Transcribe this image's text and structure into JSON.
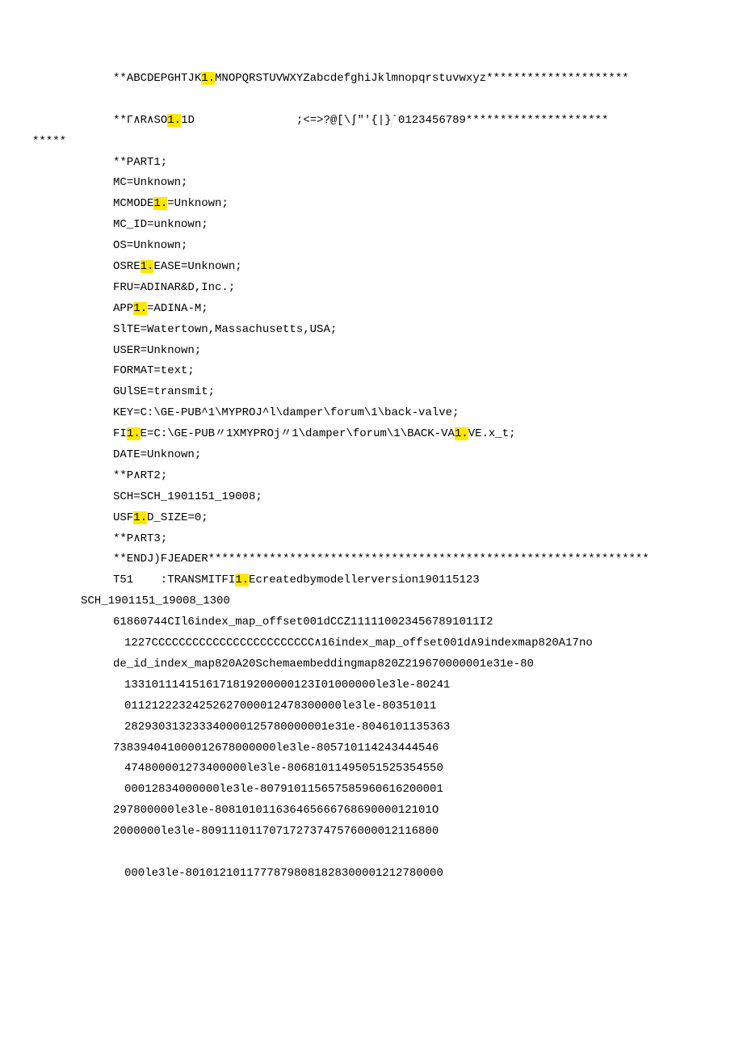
{
  "lines": [
    {
      "cls": "indent1",
      "segs": [
        {
          "t": "**ABCDEPGHTJK"
        },
        {
          "t": "1.",
          "hl": true
        },
        {
          "t": "MNOPQRSTUVWXYZabcdefghiJklmnopqrstuvwxyz*********************"
        }
      ]
    },
    {
      "cls": "blank"
    },
    {
      "cls": "indent1",
      "segs": [
        {
          "t": "**Γ∧R∧SO"
        },
        {
          "t": "1.",
          "hl": true
        },
        {
          "t": "1D               ;<=>?@[\\∫\"'{|}`0123456789*********************"
        }
      ]
    },
    {
      "cls": "noindent",
      "segs": [
        {
          "t": "*****"
        }
      ]
    },
    {
      "cls": "indent1",
      "segs": [
        {
          "t": "**PART1;"
        }
      ]
    },
    {
      "cls": "indent1",
      "segs": [
        {
          "t": "MC=Unknown;"
        }
      ]
    },
    {
      "cls": "indent1",
      "segs": [
        {
          "t": "MCMODE"
        },
        {
          "t": "1.",
          "hl": true
        },
        {
          "t": "=Unknown;"
        }
      ]
    },
    {
      "cls": "indent1",
      "segs": [
        {
          "t": "MC_ID=unknown;"
        }
      ]
    },
    {
      "cls": "indent1",
      "segs": [
        {
          "t": "OS=Unknown;"
        }
      ]
    },
    {
      "cls": "indent1",
      "segs": [
        {
          "t": "OSRE"
        },
        {
          "t": "1.",
          "hl": true
        },
        {
          "t": "EASE=Unknown;"
        }
      ]
    },
    {
      "cls": "indent1",
      "segs": [
        {
          "t": "FRU=ADINAR&D,Inc.;"
        }
      ]
    },
    {
      "cls": "indent1",
      "segs": [
        {
          "t": "APP"
        },
        {
          "t": "1.",
          "hl": true
        },
        {
          "t": "=ADINA-M;"
        }
      ]
    },
    {
      "cls": "indent1",
      "segs": [
        {
          "t": "SlTE=Watertown,Massachusetts,USA;"
        }
      ]
    },
    {
      "cls": "indent1",
      "segs": [
        {
          "t": "USER=Unknown;"
        }
      ]
    },
    {
      "cls": "indent1",
      "segs": [
        {
          "t": "FORMAT=text;"
        }
      ]
    },
    {
      "cls": "indent1",
      "segs": [
        {
          "t": "GUlSE=transmit;"
        }
      ]
    },
    {
      "cls": "indent1",
      "segs": [
        {
          "t": "KEY=C:\\GE-PUB^1\\MYPROJ^l\\damper\\forum\\1\\back-valve;"
        }
      ]
    },
    {
      "cls": "indent1",
      "segs": [
        {
          "t": "FI"
        },
        {
          "t": "1.",
          "hl": true
        },
        {
          "t": "E=C:\\GE-PUB〃1XMYPROj〃1\\damper\\forum\\1\\BACK-VA"
        },
        {
          "t": "1.",
          "hl": true
        },
        {
          "t": "VE.x_t;"
        }
      ]
    },
    {
      "cls": "indent1",
      "segs": [
        {
          "t": "DATE=Unknown;"
        }
      ]
    },
    {
      "cls": "indent1",
      "segs": [
        {
          "t": "**P∧RT2;"
        }
      ]
    },
    {
      "cls": "indent1",
      "segs": [
        {
          "t": "SCH=SCH_1901151_19008;"
        }
      ]
    },
    {
      "cls": "indent1",
      "segs": [
        {
          "t": "USF"
        },
        {
          "t": "1.",
          "hl": true
        },
        {
          "t": "D_SIZE=0;"
        }
      ]
    },
    {
      "cls": "indent1",
      "segs": [
        {
          "t": "**P∧RT3;"
        }
      ]
    },
    {
      "cls": "indent1",
      "segs": [
        {
          "t": "**ENDJ)FJEADER*****************************************************************"
        }
      ]
    },
    {
      "cls": "indent1",
      "segs": [
        {
          "t": "T51    :TRANSMITFI"
        },
        {
          "t": "1.",
          "hl": true
        },
        {
          "t": "Ecreatedbymodellerversion190115123"
        }
      ]
    },
    {
      "cls": "indent0",
      "segs": [
        {
          "t": "SCH_1901151_19008_1300"
        }
      ]
    },
    {
      "cls": "indent1",
      "segs": [
        {
          "t": "61860744CIl6index_map_offset001dCCZ1111100234567891011I2"
        }
      ]
    },
    {
      "cls": "indent2",
      "segs": [
        {
          "t": "1227CCCCCCCCCCCCCCCCCCCCCCCC∧16index_map_offset001d∧9indexmap820A17no"
        }
      ]
    },
    {
      "cls": "indent1",
      "segs": [
        {
          "t": "de_id_index_map820A20Schemaembeddingmap820Z219670000001e31e-80"
        }
      ]
    },
    {
      "cls": "indent2",
      "segs": [
        {
          "t": "1331011141516171819200000123I01000000le3le-80241"
        }
      ]
    },
    {
      "cls": "indent2",
      "segs": [
        {
          "t": "01121222324252627000012478300000le3le-80351011"
        }
      ]
    },
    {
      "cls": "indent2",
      "segs": [
        {
          "t": "282930313233340000125780000001e31e-8046101135363"
        }
      ]
    },
    {
      "cls": "indent1",
      "segs": [
        {
          "t": "738394041000012678000000le3le-805710114243444546"
        }
      ]
    },
    {
      "cls": "indent2",
      "segs": [
        {
          "t": "474800001273400000le3le-80681011495051525354550"
        }
      ]
    },
    {
      "cls": "indent2",
      "segs": [
        {
          "t": "00012834000000le3le-807910115657585960616200001"
        }
      ]
    },
    {
      "cls": "indent1",
      "segs": [
        {
          "t": "297800000le3le-80810101163646566676869000012101O"
        }
      ]
    },
    {
      "cls": "indent1",
      "segs": [
        {
          "t": "2000000le3le-80911101170717273747576000012116800"
        }
      ]
    },
    {
      "cls": "blank"
    },
    {
      "cls": "indent2",
      "segs": [
        {
          "t": "000le3le-80101210117778798081828300001212780000"
        }
      ]
    }
  ]
}
